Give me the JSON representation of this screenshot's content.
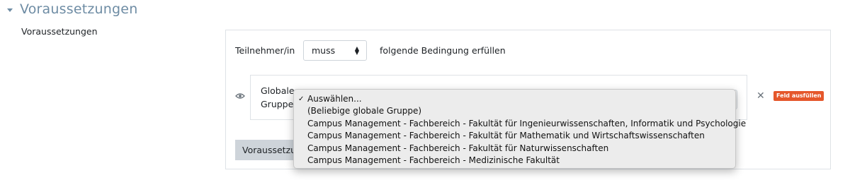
{
  "section": {
    "title": "Voraussetzungen",
    "expanded_icon": "caret-down-icon"
  },
  "field_label": "Voraussetzungen",
  "condition_row": {
    "prefix": "Teilnehmer/in",
    "select_value": "muss",
    "suffix": "folgende Bedingung erfüllen"
  },
  "condition": {
    "eye_icon": "eye-icon",
    "label_line1": "Globale",
    "label_line2": "Gruppe",
    "close_icon": "close-icon",
    "badge": "Feld ausfüllen"
  },
  "add_button_label": "Voraussetzungen hinzufügen",
  "dropdown": {
    "selected_index": 0,
    "options": [
      "Auswählen...",
      "(Beliebige globale Gruppe)",
      "Campus Management - Fachbereich - Fakultät für Ingenieurwissenschaften, Informatik und Psychologie",
      "Campus Management - Fachbereich - Fakultät für Mathematik und Wirtschaftswissenschaften",
      "Campus Management - Fachbereich - Fakultät für Naturwissenschaften",
      "Campus Management - Fachbereich - Medizinische Fakultät"
    ]
  },
  "colors": {
    "accent": "#6e8ca4",
    "badge": "#e5572b",
    "button": "#ced4da"
  }
}
